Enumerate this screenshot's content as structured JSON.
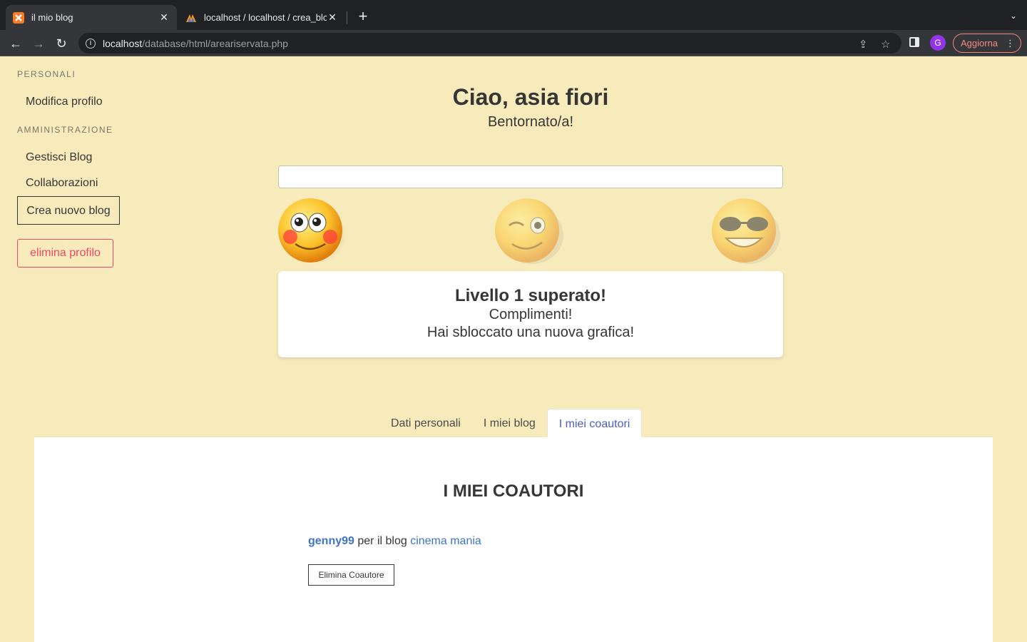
{
  "browser": {
    "tabs": [
      {
        "title": "il mio blog",
        "active": true
      },
      {
        "title": "localhost / localhost / crea_blog",
        "active": false
      }
    ],
    "url_host": "localhost",
    "url_path": "/database/html/areariservata.php",
    "avatar_letter": "G",
    "update_label": "Aggiorna"
  },
  "sidebar": {
    "sections": [
      {
        "heading": "PERSONALI",
        "items": [
          "Modifica profilo"
        ]
      },
      {
        "heading": "AMMINISTRAZIONE",
        "items": [
          "Gestisci Blog",
          "Collaborazioni"
        ]
      }
    ],
    "create_blog": "Crea nuovo blog",
    "delete_profile": "elimina profilo"
  },
  "header": {
    "greeting": "Ciao, asia fiori",
    "subtitle": "Bentornato/a!"
  },
  "level": {
    "progress": 0.0,
    "emojis": [
      "blush-face-icon",
      "wink-face-icon",
      "sunglasses-face-icon"
    ],
    "title": "Livello 1 superato!",
    "line1": "Complimenti!",
    "line2": "Hai sbloccato una nuova grafica!"
  },
  "tabs": [
    "Dati personali",
    "I miei blog",
    "I miei coautori"
  ],
  "active_tab": "I miei coautori",
  "coauthors": {
    "title": "I MIEI COAUTORI",
    "entries": [
      {
        "user": "genny99",
        "middle": "per il blog",
        "blog": "cinema mania",
        "action": "Elimina Coautore"
      }
    ]
  },
  "colors": {
    "background": "#f7ebbc",
    "link": "#3e75c8",
    "danger": "#f14668",
    "accent": "#485fc7"
  }
}
